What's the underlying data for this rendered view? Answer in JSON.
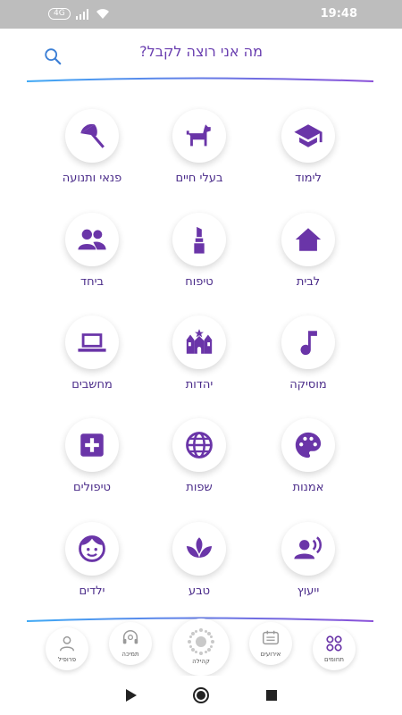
{
  "status_bar": {
    "network": "4G",
    "time": "19:48"
  },
  "search": {
    "placeholder": "מה אני רוצה לקבל?"
  },
  "categories": [
    {
      "label": "לימוד",
      "icon": "graduation-cap-icon"
    },
    {
      "label": "בעלי חיים",
      "icon": "dog-icon"
    },
    {
      "label": "פנאי ותנועה",
      "icon": "beach-umbrella-icon"
    },
    {
      "label": "לבית",
      "icon": "home-icon"
    },
    {
      "label": "טיפוח",
      "icon": "lipstick-icon"
    },
    {
      "label": "ביחד",
      "icon": "people-icon"
    },
    {
      "label": "מוסיקה",
      "icon": "music-note-icon"
    },
    {
      "label": "יהדות",
      "icon": "synagogue-icon"
    },
    {
      "label": "מחשבים",
      "icon": "laptop-icon"
    },
    {
      "label": "אמנות",
      "icon": "palette-icon"
    },
    {
      "label": "שפות",
      "icon": "globe-icon"
    },
    {
      "label": "טיפולים",
      "icon": "medical-cross-icon"
    },
    {
      "label": "ייעוץ",
      "icon": "speaking-person-icon"
    },
    {
      "label": "טבע",
      "icon": "lotus-icon"
    },
    {
      "label": "ילדים",
      "icon": "child-face-icon"
    }
  ],
  "bottom_nav": {
    "profile": "פרופיל",
    "support": "תמיכה",
    "community": "קהילה",
    "events": "אירועים",
    "fields": "תחומים"
  },
  "colors": {
    "accent": "#6a35a8",
    "gradient_start": "#3fa9f5",
    "gradient_end": "#8a4fd8"
  }
}
